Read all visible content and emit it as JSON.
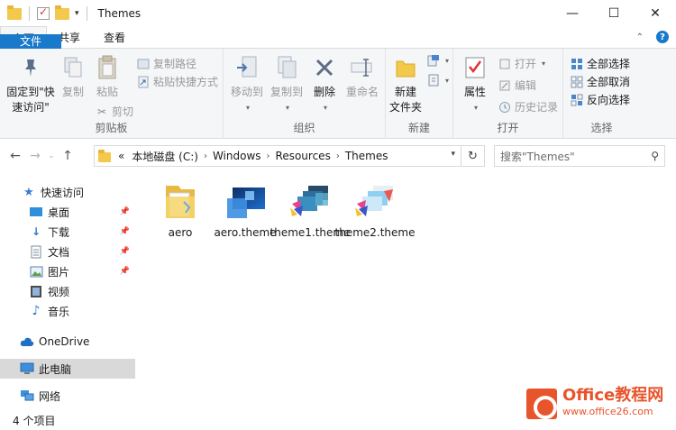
{
  "window": {
    "title": "Themes",
    "controls": {
      "minimize": "—",
      "maximize": "☐",
      "close": "✕"
    }
  },
  "tabs": [
    {
      "label": "文件"
    },
    {
      "label": "主页"
    },
    {
      "label": "共享"
    },
    {
      "label": "查看"
    }
  ],
  "ribbon": {
    "clipboard": {
      "label": "剪贴板",
      "pin_quick_access": "固定到\"快\n速访问\"",
      "copy": "复制",
      "paste": "粘贴",
      "copy_path": "复制路径",
      "paste_shortcut": "粘贴快捷方式",
      "cut": "剪切"
    },
    "organize": {
      "label": "组织",
      "move_to": "移动到",
      "copy_to": "复制到",
      "delete": "删除",
      "rename": "重命名"
    },
    "new": {
      "label": "新建",
      "new_folder": "新建\n文件夹"
    },
    "open": {
      "label": "打开",
      "properties": "属性",
      "open": "打开",
      "edit": "编辑",
      "history": "历史记录"
    },
    "select": {
      "label": "选择",
      "select_all": "全部选择",
      "select_none": "全部取消",
      "invert": "反向选择"
    }
  },
  "address": {
    "prefix": "«",
    "crumbs": [
      "本地磁盘 (C:)",
      "Windows",
      "Resources",
      "Themes"
    ],
    "search_placeholder": "搜索\"Themes\""
  },
  "nav": {
    "quick_access": "快速访问",
    "desktop": "桌面",
    "downloads": "下载",
    "documents": "文档",
    "pictures": "图片",
    "videos": "视频",
    "music": "音乐",
    "onedrive": "OneDrive",
    "this_pc": "此电脑",
    "network": "网络"
  },
  "files": [
    {
      "name": "aero",
      "type": "folder"
    },
    {
      "name": "aero.theme",
      "type": "theme"
    },
    {
      "name": "theme1.theme",
      "type": "theme"
    },
    {
      "name": "theme2.theme",
      "type": "theme"
    }
  ],
  "status": {
    "count": "4 个项目"
  },
  "watermark": {
    "brand": "Office教程网",
    "url": "www.office26.com"
  },
  "colors": {
    "accent": "#1979ca",
    "ribbon_bg": "#f5f6f7",
    "selection": "#d9d9d9",
    "watermark": "#e8542b"
  }
}
